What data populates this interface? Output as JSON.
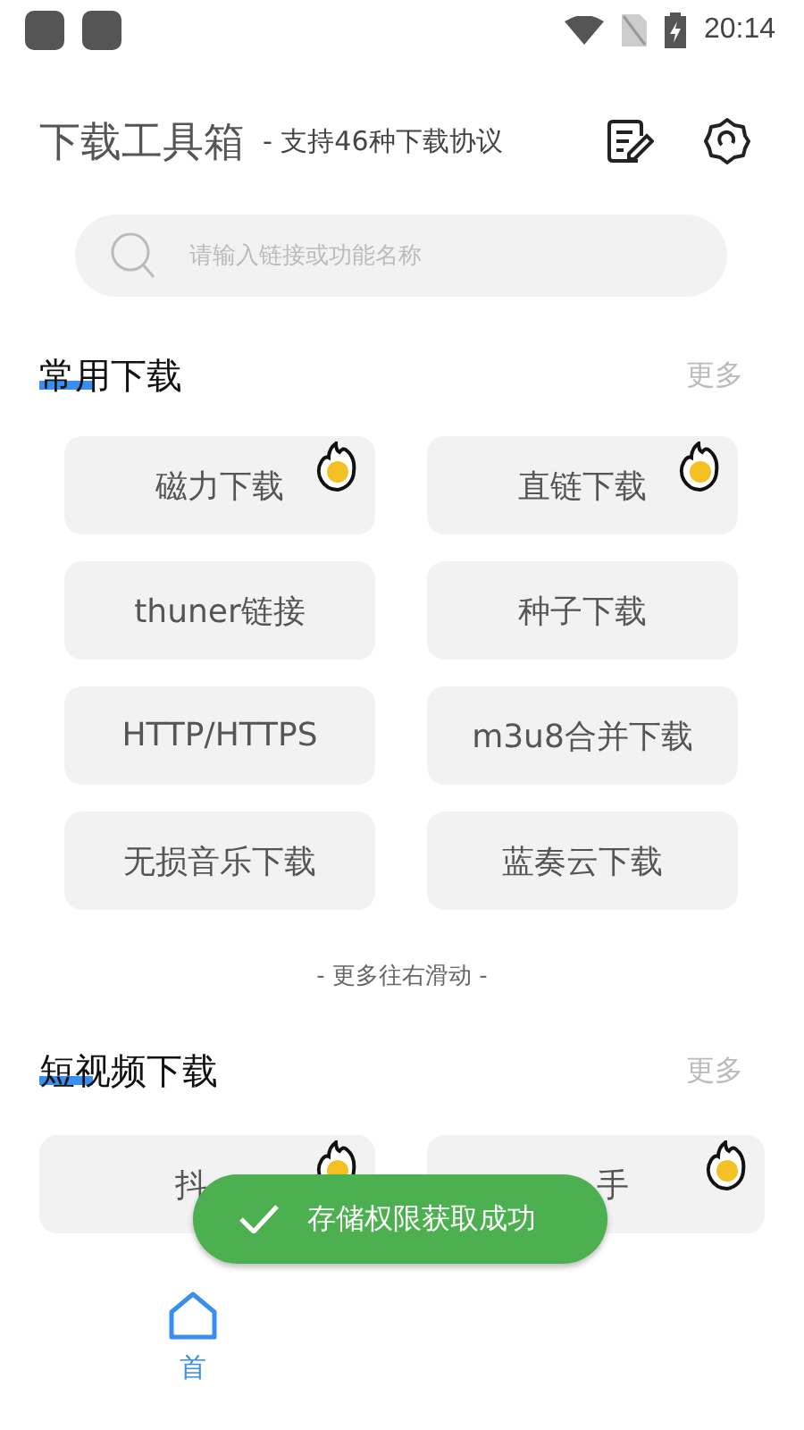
{
  "status_bar": {
    "time": "20:14"
  },
  "header": {
    "title": "下载工具箱",
    "subtitle": "- 支持46种下载协议"
  },
  "search": {
    "placeholder": "请输入链接或功能名称"
  },
  "sections": [
    {
      "title": "常用下载",
      "more": "更多",
      "items": [
        {
          "label": "磁力下载",
          "hot": true
        },
        {
          "label": "直链下载",
          "hot": true
        },
        {
          "label": "thuner链接",
          "hot": false
        },
        {
          "label": "种子下载",
          "hot": false
        },
        {
          "label": "HTTP/HTTPS",
          "hot": false
        },
        {
          "label": "m3u8合并下载",
          "hot": false
        },
        {
          "label": "无损音乐下载",
          "hot": false
        },
        {
          "label": "蓝奏云下载",
          "hot": false
        }
      ],
      "hint": "- 更多往右滑动 -"
    },
    {
      "title": "短视频下载",
      "more": "更多",
      "items": [
        {
          "label": "抖",
          "hot": true,
          "kind": "cut_left"
        },
        {
          "label": "手",
          "hot": true,
          "kind": "cut_right"
        }
      ]
    }
  ],
  "toast": {
    "text": "存储权限获取成功"
  },
  "bottom_nav": [
    {
      "label": "首",
      "selected": true
    }
  ]
}
